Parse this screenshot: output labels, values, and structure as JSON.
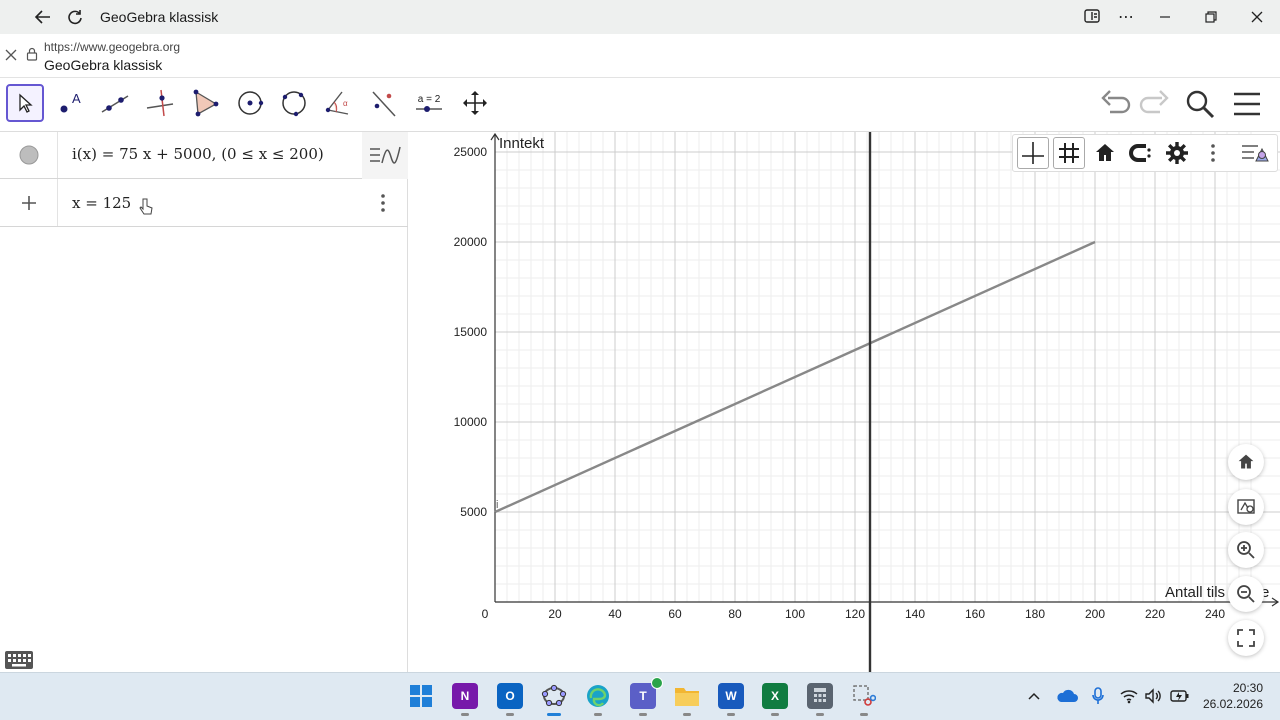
{
  "titlebar": {
    "title": "GeoGebra klassisk",
    "more_glyph": "⋯"
  },
  "urlbar": {
    "url": "https://www.geogebra.org",
    "page_title": "GeoGebra klassisk"
  },
  "toolbar": {
    "tools": [
      "move-tool",
      "point-tool",
      "line-tool",
      "perpendicular-line-tool",
      "polygon-tool",
      "circle-center-point-tool",
      "circle-three-points-tool",
      "angle-tool",
      "reflect-tool",
      "slider-tool",
      "move-graphics-view-tool"
    ],
    "slider_label": "a = 2"
  },
  "algebra": {
    "rows": [
      {
        "text": "i(x)  =  75 x + 5000,    (0 ≤ x ≤ 200)"
      },
      {
        "text": "x = 125"
      }
    ]
  },
  "chart_data": {
    "type": "line",
    "title": "",
    "xlabel": "Antall tils",
    "xlabel_suffix": "e",
    "ylabel": "Inntekt",
    "xlim": [
      0,
      252
    ],
    "ylim": [
      0,
      25700
    ],
    "x_ticks": [
      0,
      20,
      40,
      60,
      80,
      100,
      120,
      140,
      160,
      180,
      200,
      220,
      240
    ],
    "y_ticks": [
      5000,
      10000,
      15000,
      20000,
      25000
    ],
    "grid": true,
    "series": [
      {
        "name": "i",
        "x": [
          0,
          200
        ],
        "y": [
          5000,
          20000
        ],
        "color": "#888888"
      }
    ],
    "vertical_line": {
      "x": 125,
      "color": "#333333"
    },
    "point_label": "i"
  },
  "taskbar": {
    "apps": [
      {
        "name": "windows-start",
        "color": "#1f7fd8",
        "glyph": ""
      },
      {
        "name": "onenote",
        "color": "#7719aa",
        "glyph": "N"
      },
      {
        "name": "outlook",
        "color": "#0a64c2",
        "glyph": "O"
      },
      {
        "name": "geogebra",
        "color": "#7a7a9a",
        "glyph": ""
      },
      {
        "name": "edge",
        "color": "#1aa3c8",
        "glyph": ""
      },
      {
        "name": "teams",
        "color": "#5b5fc7",
        "glyph": "T"
      },
      {
        "name": "file-explorer",
        "color": "#f2b632",
        "glyph": ""
      },
      {
        "name": "word",
        "color": "#185abd",
        "glyph": "W"
      },
      {
        "name": "excel",
        "color": "#107c41",
        "glyph": "X"
      },
      {
        "name": "calculator",
        "color": "#5a6470",
        "glyph": ""
      },
      {
        "name": "snipping-tool",
        "color": "#c0c0c0",
        "glyph": ""
      }
    ],
    "time": "20:30",
    "date": "26.02.2026"
  },
  "colors": {
    "accent": "#6557d2",
    "graph_line": "#888888",
    "grid_major": "#cccccc",
    "grid_minor": "#eeeeee"
  }
}
